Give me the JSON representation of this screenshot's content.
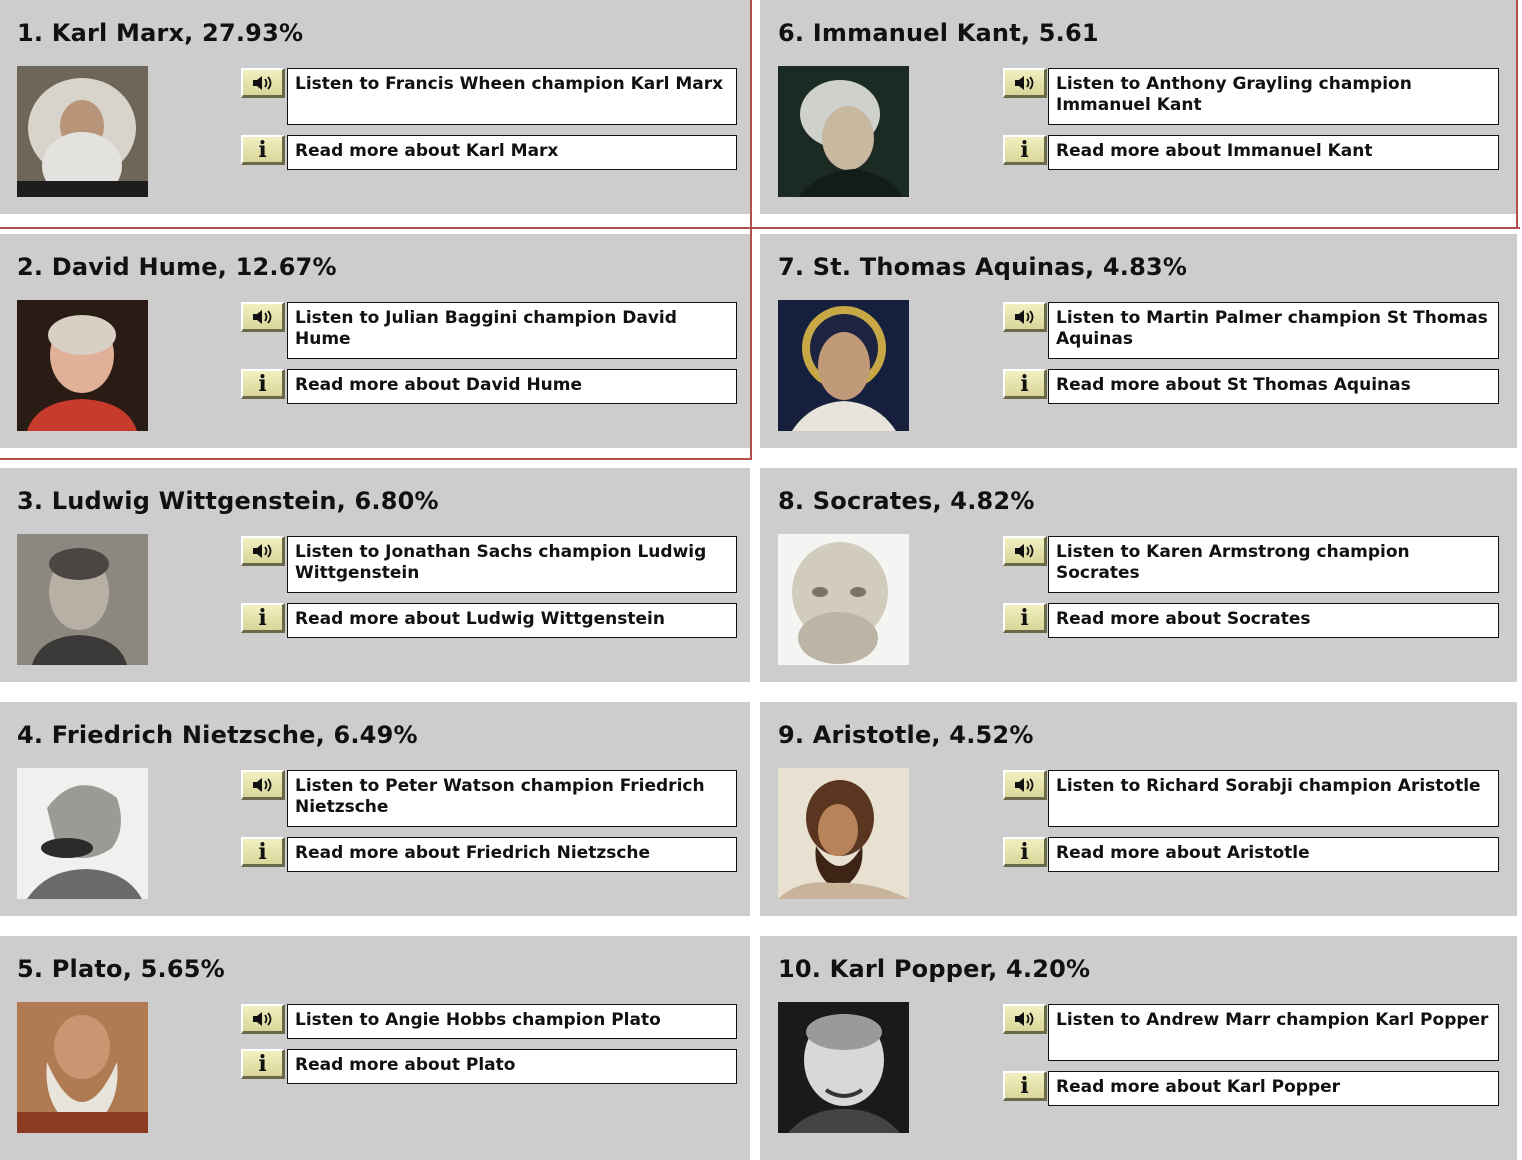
{
  "entries": [
    {
      "title": "1. Karl Marx, 27.93%",
      "listen": "Listen to Francis Wheen champion Karl Marx",
      "read": "Read more about Karl Marx"
    },
    {
      "title": "2. David Hume, 12.67%",
      "listen": "Listen to Julian Baggini champion David Hume",
      "read": "Read more about David Hume"
    },
    {
      "title": "3. Ludwig Wittgenstein, 6.80%",
      "listen": "Listen to Jonathan Sachs champion Ludwig Wittgenstein",
      "read": "Read more about Ludwig Wittgenstein"
    },
    {
      "title": "4. Friedrich Nietzsche, 6.49%",
      "listen": "Listen to Peter Watson champion Friedrich Nietzsche",
      "read": "Read more about Friedrich Nietzsche"
    },
    {
      "title": "5. Plato, 5.65%",
      "listen": "Listen to Angie Hobbs champion Plato",
      "read": "Read more about Plato"
    },
    {
      "title": "6. Immanuel Kant, 5.61",
      "listen": "Listen to Anthony Grayling champion Immanuel Kant",
      "read": "Read more about Immanuel Kant"
    },
    {
      "title": "7. St. Thomas Aquinas, 4.83%",
      "listen": "Listen to Martin Palmer champion St Thomas Aquinas",
      "read": "Read more about St Thomas Aquinas"
    },
    {
      "title": "8. Socrates, 4.82%",
      "listen": "Listen to Karen Armstrong champion Socrates",
      "read": "Read more about Socrates"
    },
    {
      "title": "9. Aristotle, 4.52%",
      "listen": "Listen to Richard Sorabji champion Aristotle",
      "read": "Read more about Aristotle"
    },
    {
      "title": "10. Karl Popper, 4.20%",
      "listen": "Listen to Andrew Marr champion Karl Popper",
      "read": "Read more about Karl Popper"
    }
  ],
  "icons": {
    "listen": "speaker-icon",
    "info": "info-icon",
    "info_glyph": "i"
  },
  "colors": {
    "panel_bg": "#cdcdcd",
    "button_bg": "#e8e6b0",
    "selection_border": "#b05050"
  }
}
